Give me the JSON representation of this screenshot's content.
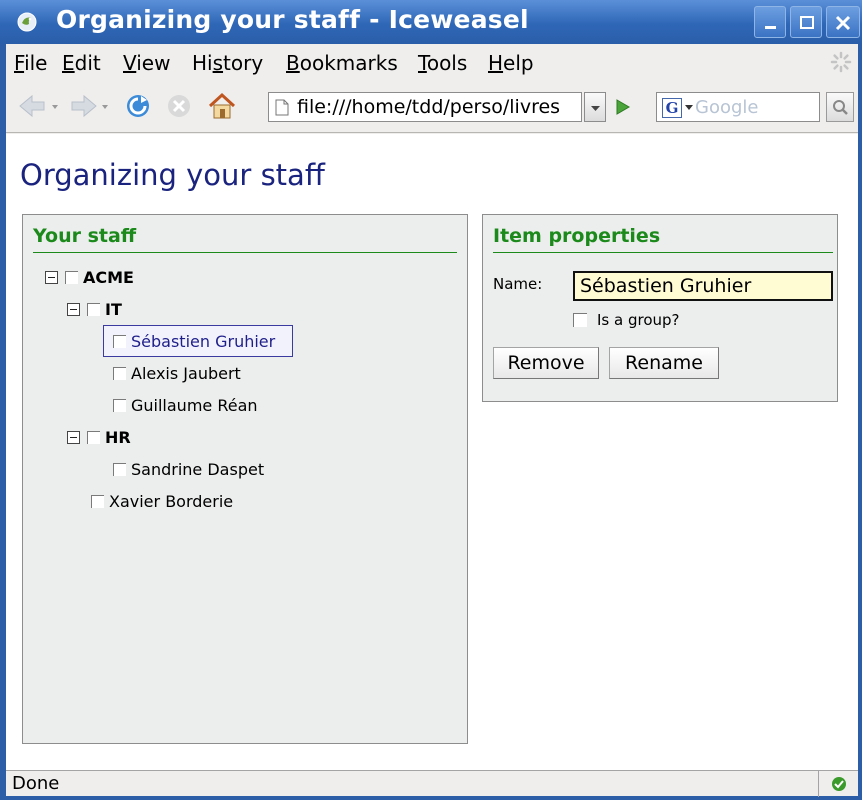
{
  "window": {
    "title": "Organizing your staff - Iceweasel"
  },
  "menubar": {
    "items": [
      "File",
      "Edit",
      "View",
      "History",
      "Bookmarks",
      "Tools",
      "Help"
    ],
    "mnemonics": [
      "F",
      "E",
      "V",
      "s",
      "B",
      "T",
      "H"
    ]
  },
  "navbar": {
    "url": "file:///home/tdd/perso/livres",
    "search_placeholder": "Google",
    "search_engine_letter": "G"
  },
  "page": {
    "title": "Organizing your staff",
    "staff_panel": {
      "header": "Your staff",
      "tree": [
        {
          "label": "ACME",
          "group": true
        },
        {
          "label": "IT",
          "group": true
        },
        {
          "label": "Sébastien Gruhier",
          "group": false,
          "selected": true
        },
        {
          "label": "Alexis Jaubert",
          "group": false
        },
        {
          "label": "Guillaume Réan",
          "group": false
        },
        {
          "label": "HR",
          "group": true
        },
        {
          "label": "Sandrine Daspet",
          "group": false
        },
        {
          "label": "Xavier Borderie",
          "group": false
        }
      ]
    },
    "props_panel": {
      "header": "Item properties",
      "name_label": "Name:",
      "name_value": "Sébastien Gruhier",
      "group_label": "Is a group?",
      "remove_label": "Remove",
      "rename_label": "Rename"
    }
  },
  "statusbar": {
    "text": "Done"
  },
  "colors": {
    "titlebar": "#2f67b7",
    "panel_header": "#1b8a1b",
    "page_title": "#1a237e",
    "name_field_bg": "#fffbd3"
  }
}
